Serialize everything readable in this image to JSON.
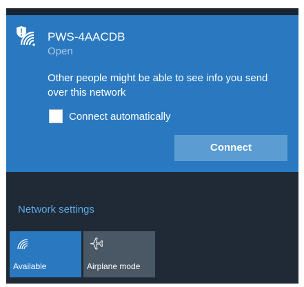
{
  "network": {
    "ssid": "PWS-4AACDB",
    "security": "Open",
    "warning": "Other people might be able to see info you send over this network",
    "connect_automatically": {
      "label": "Connect automatically",
      "checked": false
    },
    "connect_label": "Connect",
    "icon": "wifi-warning-shield-icon"
  },
  "footer": {
    "network_settings_label": "Network settings",
    "tiles": [
      {
        "label": "Available",
        "icon": "wifi-icon",
        "active": true
      },
      {
        "label": "Airplane mode",
        "icon": "airplane-icon",
        "active": false
      }
    ]
  },
  "colors": {
    "accent": "#2a79c0",
    "panel_background": "#1f2a36",
    "button_background": "#5b9cd3",
    "link": "#5ea9e6",
    "inactive_tile": "#4a5866"
  }
}
